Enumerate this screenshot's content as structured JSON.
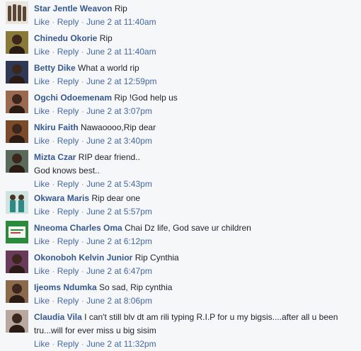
{
  "meta": {
    "like_label": "Like",
    "reply_label": "Reply",
    "separator": "·"
  },
  "comments": [
    {
      "author": "Star Jentle Weavon",
      "text": "Rip",
      "time": "June 2 at 11:40am",
      "avatar_icon": "hair-weave-bundles",
      "avatar_color": "#6b5a46"
    },
    {
      "author": "Chinedu Okorie",
      "text": "Rip",
      "time": "June 2 at 11:40am",
      "avatar_icon": "person-photo",
      "avatar_color": "#8a7a3a"
    },
    {
      "author": "Betty Dike",
      "text": "What a world rip",
      "time": "June 2 at 12:59pm",
      "avatar_icon": "person-photo",
      "avatar_color": "#2e3a55"
    },
    {
      "author": "Ogchi Odoemenam",
      "text": "Rip !God help us",
      "time": "June 2 at 3:07pm",
      "avatar_icon": "person-photo",
      "avatar_color": "#9a6a50"
    },
    {
      "author": "Nkiru Faith",
      "text": "Nawaoooo,Rip dear",
      "time": "June 2 at 3:40pm",
      "avatar_icon": "person-photo",
      "avatar_color": "#7a4a2a"
    },
    {
      "author": "Mizta Czar",
      "text": "RIP dear friend..\nGod knows best..",
      "time": "June 2 at 5:43pm",
      "avatar_icon": "person-photo",
      "avatar_color": "#5a6a5a"
    },
    {
      "author": "Okwara Maris",
      "text": "Rip dear one",
      "time": "June 2 at 5:57pm",
      "avatar_icon": "two-people-photo",
      "avatar_color": "#3a7a7a"
    },
    {
      "author": "Nneoma Charles Oma",
      "text": "Chai Dz life, God save ur children",
      "time": "June 2 at 6:12pm",
      "avatar_icon": "green-card-image",
      "avatar_color": "#2e8a3a"
    },
    {
      "author": "Okonoboh Kelvin Junior",
      "text": "Rip Cynthia",
      "time": "June 2 at 6:47pm",
      "avatar_icon": "person-photo",
      "avatar_color": "#6a3a5a"
    },
    {
      "author": "Ijeoms Ndumka",
      "text": "So sad, Rip cynthia",
      "time": "June 2 at 8:06pm",
      "avatar_icon": "person-photo",
      "avatar_color": "#8a6a4a"
    },
    {
      "author": "Claudia Vila",
      "text": "I can't still blv dt am rili typing R.I.P for u my bigsis....after all u been tru...will for ever miss u big sisim",
      "time": "June 2 at 11:32pm",
      "avatar_icon": "person-photo",
      "avatar_color": "#b8a8a0"
    }
  ]
}
